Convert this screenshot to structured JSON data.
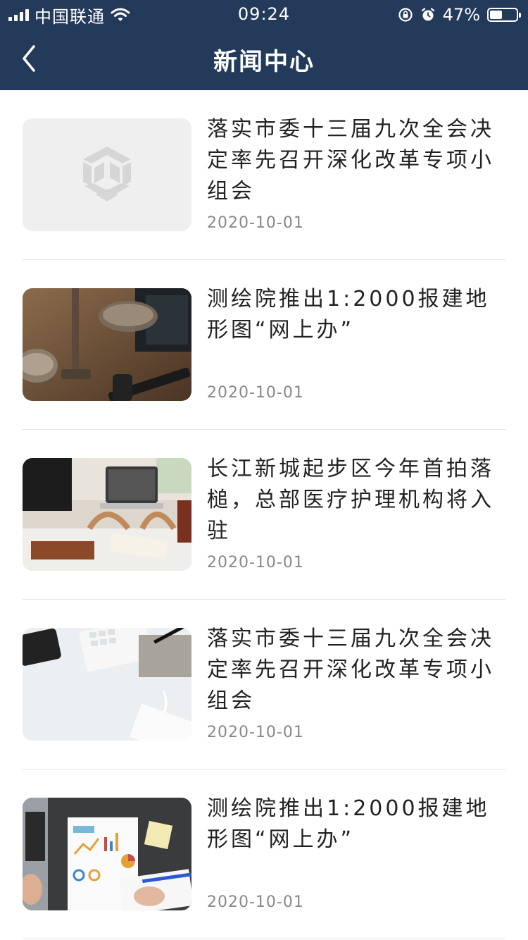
{
  "status_bar": {
    "carrier": "中国联通",
    "time": "09:24",
    "battery": "47%",
    "battery_level": 0.47
  },
  "nav": {
    "title": "新闻中心",
    "back_icon": "chevron-left-icon"
  },
  "articles": [
    {
      "title": "落实市委十三届九次全会决定率先召开深化改革专项小组会",
      "date": "2020-10-01",
      "image": "placeholder-logo"
    },
    {
      "title": "测绘院推出1:2000报建地形图“网上办”",
      "date": "2020-10-01",
      "image": "scales-and-gavel-photo"
    },
    {
      "title": "长江新城起步区今年首拍落槌，总部医疗护理机构将入驻",
      "date": "2020-10-01",
      "image": "laptop-desk-photo"
    },
    {
      "title": "落实市委十三届九次全会决定率先召开深化改革专项小组会",
      "date": "2020-10-01",
      "image": "keyboard-phone-desk-photo"
    },
    {
      "title": "测绘院推出1:2000报建地形图“网上办”",
      "date": "2020-10-01",
      "image": "charts-documents-photo"
    }
  ],
  "colors": {
    "header_bg": "#233a5b",
    "title_text": "#222222",
    "date_text": "#888888",
    "divider": "#e4e4e4"
  }
}
